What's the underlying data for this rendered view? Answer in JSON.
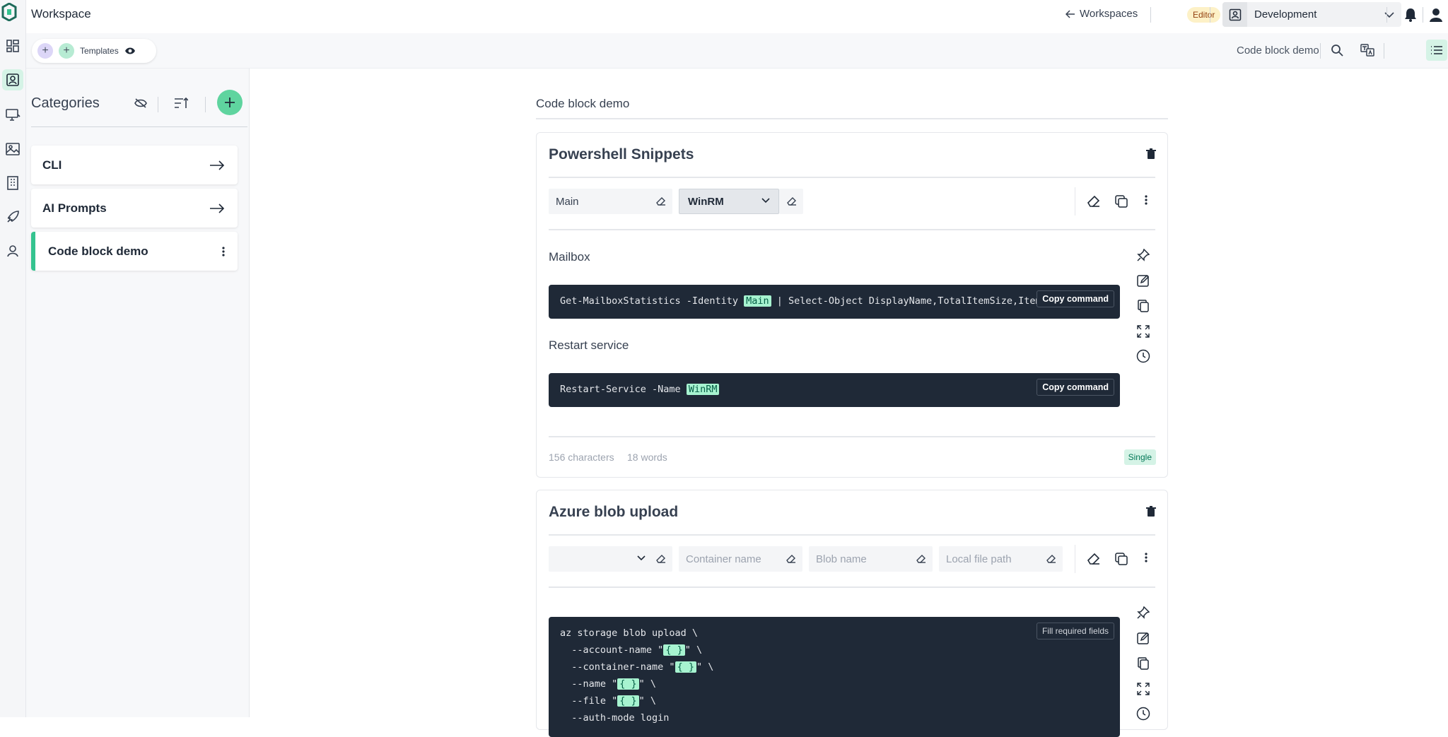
{
  "app": {
    "title": "Workspace",
    "back_label": "Workspaces",
    "role_badge": "Editor",
    "workspace_select": "Development"
  },
  "toolbar": {
    "templates_label": "Templates",
    "document_name": "Code block demo"
  },
  "categories": {
    "title": "Categories",
    "items": [
      {
        "label": "CLI"
      },
      {
        "label": "AI Prompts"
      },
      {
        "label": "Code block demo"
      }
    ]
  },
  "main": {
    "title": "Code block demo",
    "snippets": [
      {
        "title": "Powershell Snippets",
        "fields": {
          "main_value": "Main",
          "select_value": "WinRM"
        },
        "blocks": [
          {
            "label": "Mailbox",
            "code_prefix": "Get-MailboxStatistics -Identity ",
            "code_var": "Main",
            "code_suffix": " | Select-Object DisplayName,TotalItemSize,ItemCount",
            "button": "Copy command"
          },
          {
            "label": "Restart service",
            "code_prefix": "Restart-Service -Name ",
            "code_var": "WinRM",
            "button": "Copy command"
          }
        ],
        "stats": {
          "characters": "156 characters",
          "words": "18 words",
          "badge": "Single"
        }
      },
      {
        "title": "Azure blob upload",
        "fields": {
          "select_value": "",
          "container_placeholder": "Container name",
          "blob_placeholder": "Blob name",
          "file_placeholder": "Local file path"
        },
        "block": {
          "button": "Fill required fields",
          "lines": [
            {
              "prefix": "az storage blob upload \\",
              "var": "",
              "suffix": ""
            },
            {
              "prefix": "  --account-name \"",
              "var": "{ }",
              "suffix": "\" \\"
            },
            {
              "prefix": "  --container-name \"",
              "var": "{ }",
              "suffix": "\" \\"
            },
            {
              "prefix": "  --name \"",
              "var": "{ }",
              "suffix": "\" \\"
            },
            {
              "prefix": "  --file \"",
              "var": "{ }",
              "suffix": "\" \\"
            },
            {
              "prefix": "  --auth-mode login",
              "var": "",
              "suffix": ""
            }
          ]
        }
      }
    ]
  },
  "colors": {
    "accent": "#34c38f",
    "accent_light": "#d5f3e6",
    "code_bg": "#1f2937",
    "highlight": "#a7f3d0",
    "badge_yellow": "#fdf1c7"
  },
  "icons": {
    "rail": [
      "dashboard-icon",
      "contacts-icon",
      "monitor-icon",
      "image-icon",
      "building-icon",
      "rocket-icon",
      "user-icon"
    ],
    "topbar": [
      "logo-icon",
      "arrow-left-icon",
      "workspace-icon",
      "chevron-down-icon",
      "bell-icon",
      "user-icon"
    ],
    "toolbar": [
      "add-icon",
      "add-icon",
      "eye-icon",
      "search-icon",
      "translate-icon",
      "list-view-icon",
      "grid-view-icon"
    ],
    "snippet": [
      "trash-icon",
      "eraser-icon",
      "copy-icon",
      "more-vertical-icon",
      "pin-icon",
      "edit-icon",
      "copy-icon",
      "expand-icon",
      "history-icon"
    ]
  }
}
